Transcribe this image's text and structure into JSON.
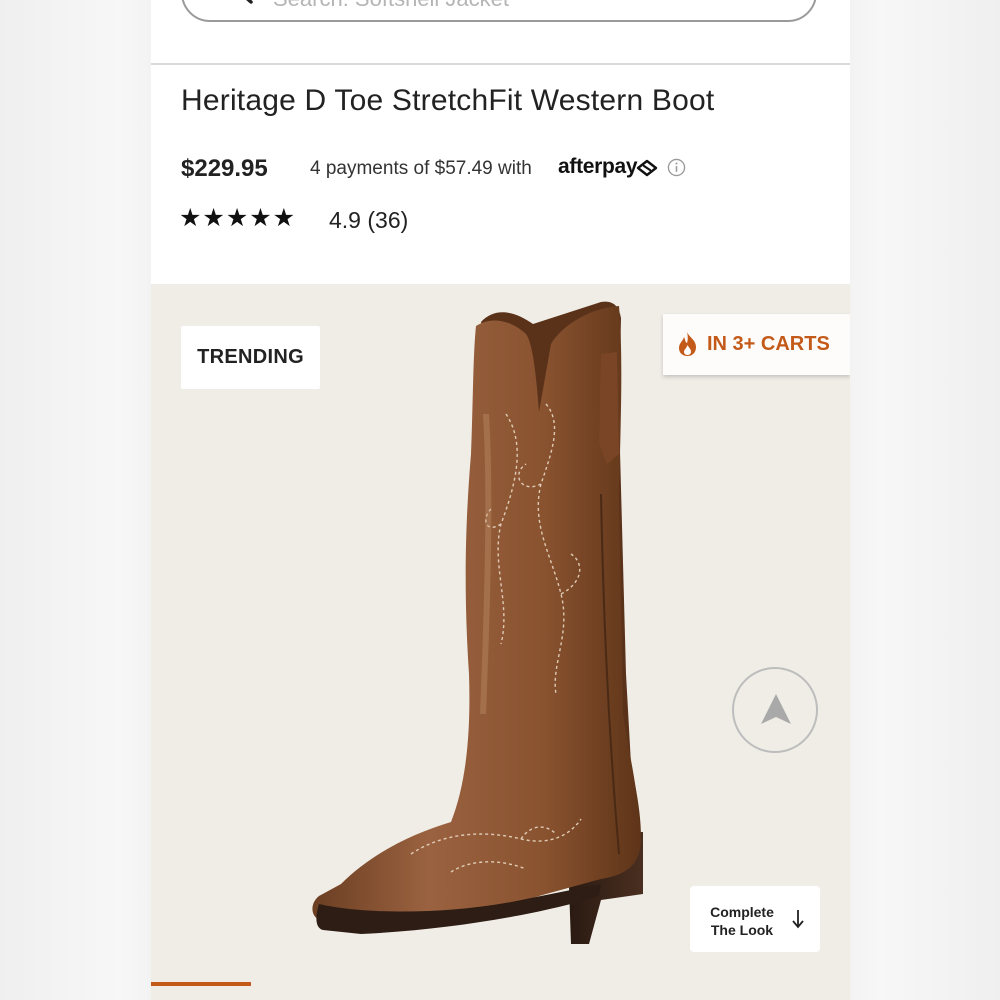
{
  "search": {
    "placeholder": "Search: Softshell Jacket"
  },
  "product": {
    "title": "Heritage D Toe StretchFit Western Boot",
    "price": "$229.95",
    "installments_text": "4 payments of $57.49 with",
    "afterpay_brand": "afterpay",
    "stars": "★★★★★",
    "rating_text": "4.9  (36)",
    "rating_value": 4.9,
    "review_count": 36
  },
  "gallery": {
    "badge_trending": "TRENDING",
    "badge_carts": "IN 3+ CARTS",
    "complete_look": "Complete The Look",
    "progress_fraction": 0.143
  },
  "icons": {
    "search": "search-icon",
    "afterpay": "afterpay-logo-icon",
    "info": "info-icon",
    "flame": "flame-icon",
    "navigation": "navigation-arrow-icon",
    "down_arrow": "arrow-down-icon"
  },
  "colors": {
    "accent": "#c45a1a",
    "gallery_bg": "#f0ede7",
    "boot_leather": "#8a5330"
  }
}
